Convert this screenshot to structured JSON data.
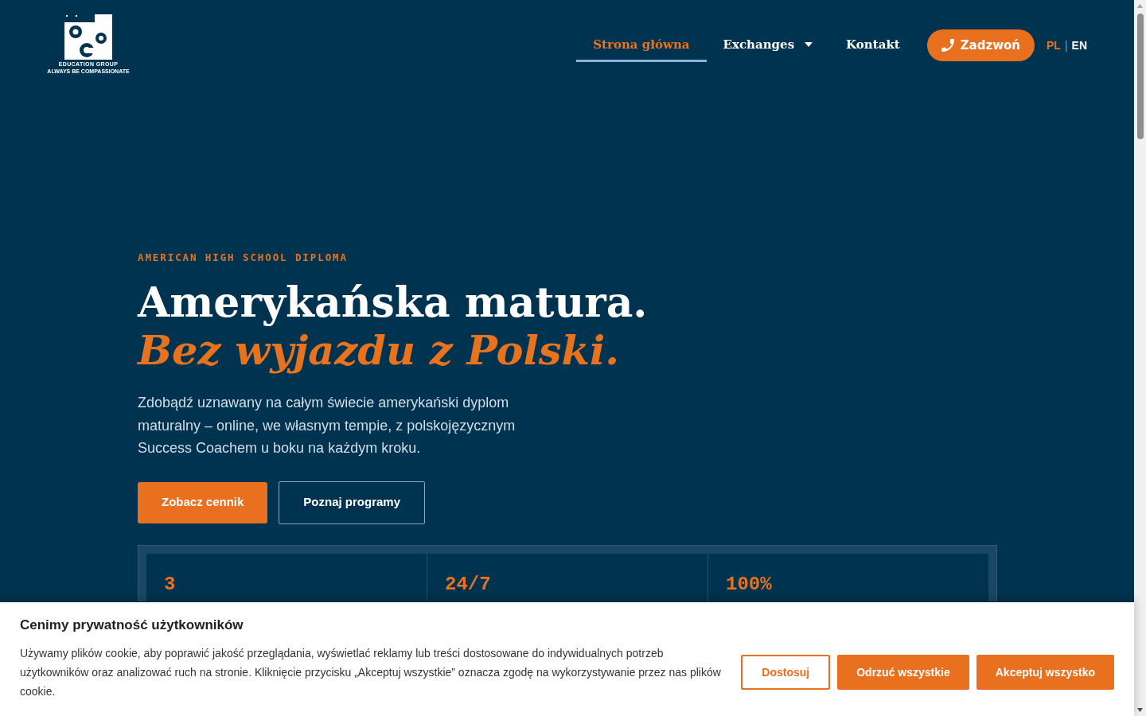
{
  "logo": {
    "name": "EDUCATION GROUP",
    "tagline": "ALWAYS BE COMPASSIONATE"
  },
  "nav": {
    "items": [
      {
        "label": "Strona główna",
        "kind": "link",
        "selected": true
      },
      {
        "label": "Exchanges",
        "kind": "dropdown",
        "selected": false
      },
      {
        "label": "Kontakt",
        "kind": "link",
        "selected": false
      }
    ],
    "call_button": "Zadzwoń",
    "languages": [
      {
        "label": "PL",
        "selected": true
      },
      {
        "label": "EN",
        "selected": false
      }
    ],
    "language_separator": "|"
  },
  "hero": {
    "eyebrow": "AMERICAN HIGH SCHOOL DIPLOMA",
    "title": "Amerykańska matura.",
    "title_accent": "Bez wyjazdu z Polski.",
    "lead": "Zdobądź uznawany na całym świecie amerykański dyplom maturalny – online, we własnym tempie, z polskojęzycznym Success Coachem u boku na każdym kroku.",
    "buttons": [
      {
        "label": "Zobacz cennik",
        "kind": "primary"
      },
      {
        "label": "Poznaj programy",
        "kind": "outline"
      }
    ],
    "stats": [
      {
        "value": "3"
      },
      {
        "value": "24/7"
      },
      {
        "value": "100%"
      }
    ]
  },
  "cookie_banner": {
    "title": "Cenimy prywatność użytkowników",
    "text": "Używamy plików cookie, aby poprawić jakość przeglądania, wyświetlać reklamy lub treści dostosowane do indywidualnych potrzeb użytkowników oraz analizować ruch na stronie. Kliknięcie przycisku „Akceptuj wszystkie” oznacza zgodę na wykorzystywanie przez nas plików cookie.",
    "buttons": [
      {
        "label": "Dostosuj",
        "kind": "outline"
      },
      {
        "label": "Odrzuć wszystkie",
        "kind": "primary"
      },
      {
        "label": "Akceptuj wszystko",
        "kind": "primary"
      }
    ]
  }
}
